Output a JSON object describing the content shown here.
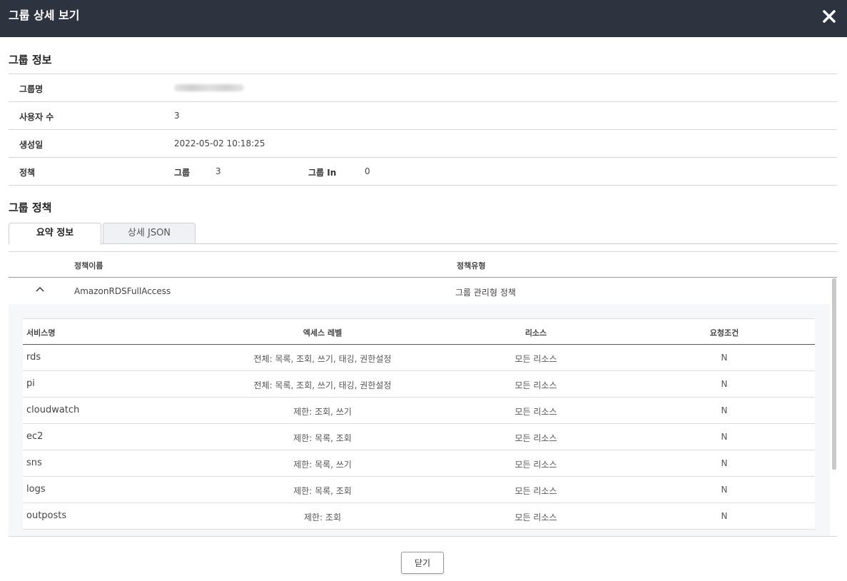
{
  "header": {
    "title": "그룹 상세 보기"
  },
  "group_info": {
    "title": "그룹 정보",
    "rows": [
      {
        "label": "그룹명",
        "value": ""
      },
      {
        "label": "사용자 수",
        "value": "3"
      },
      {
        "label": "생성일",
        "value": "2022-05-02 10:18:25"
      }
    ],
    "policy": {
      "label": "정책",
      "group_label": "그룹",
      "group_value": "3",
      "inline_label": "그룹 In",
      "inline_value": "0"
    }
  },
  "group_policy": {
    "title": "그룹 정책",
    "tabs": [
      {
        "label": "요약 정보",
        "active": true
      },
      {
        "label": "상세 JSON",
        "active": false
      }
    ],
    "columns": {
      "name": "정책이름",
      "type": "정책유형"
    },
    "policy": {
      "name": "AmazonRDSFullAccess",
      "type": "그룹 관리형 정책"
    },
    "detail_columns": {
      "service": "서비스명",
      "access": "엑세스 레벨",
      "resource": "리소스",
      "condition": "요청조건"
    },
    "detail_rows": [
      {
        "service": "rds",
        "access": "전체: 목록, 조회, 쓰기, 태깅, 권한설정",
        "resource": "모든 리소스",
        "condition": "N"
      },
      {
        "service": "pi",
        "access": "전체: 목록, 조회, 쓰기, 태깅, 권한설정",
        "resource": "모든 리소스",
        "condition": "N"
      },
      {
        "service": "cloudwatch",
        "access": "제한: 조회, 쓰기",
        "resource": "모든 리소스",
        "condition": "N"
      },
      {
        "service": "ec2",
        "access": "제한: 목록, 조회",
        "resource": "모든 리소스",
        "condition": "N"
      },
      {
        "service": "sns",
        "access": "제한: 목록, 쓰기",
        "resource": "모든 리소스",
        "condition": "N"
      },
      {
        "service": "logs",
        "access": "제한: 목록, 조회",
        "resource": "모든 리소스",
        "condition": "N"
      },
      {
        "service": "outposts",
        "access": "제한: 조회",
        "resource": "모든 리소스",
        "condition": "N"
      }
    ]
  },
  "footer": {
    "close_label": "닫기"
  }
}
